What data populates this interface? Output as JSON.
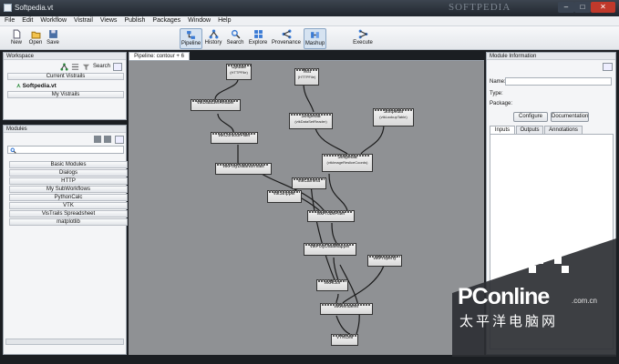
{
  "window": {
    "title": "Softpedia.vt",
    "watermark": "SOFTPEDIA"
  },
  "menu": [
    "File",
    "Edit",
    "Workflow",
    "Vistrail",
    "Views",
    "Publish",
    "Packages",
    "Window",
    "Help"
  ],
  "toolbar": {
    "new": "New",
    "open": "Open",
    "save": "Save",
    "pipeline": "Pipeline",
    "history": "History",
    "search": "Search",
    "explore": "Explore",
    "provenance": "Provenance",
    "mashup": "Mashup",
    "execute": "Execute"
  },
  "workspace": {
    "title": "Workspace",
    "search_label": "Search",
    "current_vistrails": "Current Vistrails",
    "vistrail_item": "Softpedia.vt",
    "my_vistrails": "My Vistrails"
  },
  "modules": {
    "title": "Modules",
    "items": [
      "Basic Modules",
      "Dialogs",
      "HTTP",
      "My SubWorkflows",
      "PythonCalc",
      "VTK",
      "VisTrails Spreadsheet",
      "matplotlib"
    ]
  },
  "pipeline": {
    "tab_label": "Pipeline: contour + 6",
    "nodes": [
      {
        "id": "update",
        "label": "Update",
        "sub": "(HTTPFile)"
      },
      {
        "id": "test",
        "label": "Test",
        "sub": "(HTTPFile)"
      },
      {
        "id": "reader",
        "label": "vtkDataSetReader",
        "sub": ""
      },
      {
        "id": "sp1",
        "label": "Softpedia",
        "sub": "(vtkDataSetReader)"
      },
      {
        "id": "sp2",
        "label": "Softpedia",
        "sub": "(vtkLookupTable)"
      },
      {
        "id": "contour",
        "label": "vtkContourFilter",
        "sub": ""
      },
      {
        "id": "sp3",
        "label": "Softpedia",
        "sub": "(vtkImageResliceCoords)"
      },
      {
        "id": "normals",
        "label": "vtkPolyDataNormals",
        "sub": ""
      },
      {
        "id": "camera",
        "label": "vtkCamera",
        "sub": ""
      },
      {
        "id": "stripper",
        "label": "vtkStripper",
        "sub": ""
      },
      {
        "id": "probe",
        "label": "vtkProbeFilter",
        "sub": ""
      },
      {
        "id": "mapper",
        "label": "vtkPolyDataMapper",
        "sub": ""
      },
      {
        "id": "property",
        "label": "vtkProperty",
        "sub": ""
      },
      {
        "id": "actor",
        "label": "vtkActor",
        "sub": ""
      },
      {
        "id": "renderer",
        "label": "vtkRenderer",
        "sub": ""
      },
      {
        "id": "cell",
        "label": "VTKCell",
        "sub": ""
      }
    ]
  },
  "module_info": {
    "title": "Module Information",
    "name_label": "Name:",
    "type_label": "Type:",
    "package_label": "Package:",
    "configure": "Configure",
    "documentation": "Documentation",
    "tabs": [
      "Inputs",
      "Outputs",
      "Annotations"
    ]
  },
  "logo": {
    "brand": "PConline",
    "domain": ".com.cn",
    "chinese": "太平洋电脑网"
  }
}
